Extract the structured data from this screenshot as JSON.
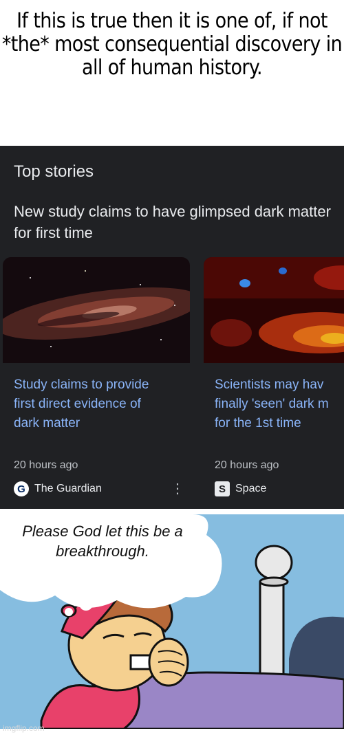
{
  "caption": "If this is true then it is one of, if not *the* most consequential discovery in all of human history.",
  "panel": {
    "title": "Top stories",
    "headline": "New study claims to have glimpsed dark matter for first time",
    "cards": [
      {
        "title_line1": "Study claims to provide",
        "title_line2": "first direct evidence of",
        "title_line3": "dark matter",
        "time": "20 hours ago",
        "source": "The Guardian",
        "source_icon": "guardian-logo-icon"
      },
      {
        "title_line1": "Scientists may hav",
        "title_line2": "finally 'seen' dark m",
        "title_line3": "for the 1st time",
        "time": "20 hours ago",
        "source": "Space",
        "source_icon": "space-logo-icon"
      }
    ],
    "colors": {
      "background": "#202124",
      "link": "#8ab4f8"
    }
  },
  "comic": {
    "speech": "Please God let this be a breakthrough."
  },
  "watermark": "imgflip.com"
}
